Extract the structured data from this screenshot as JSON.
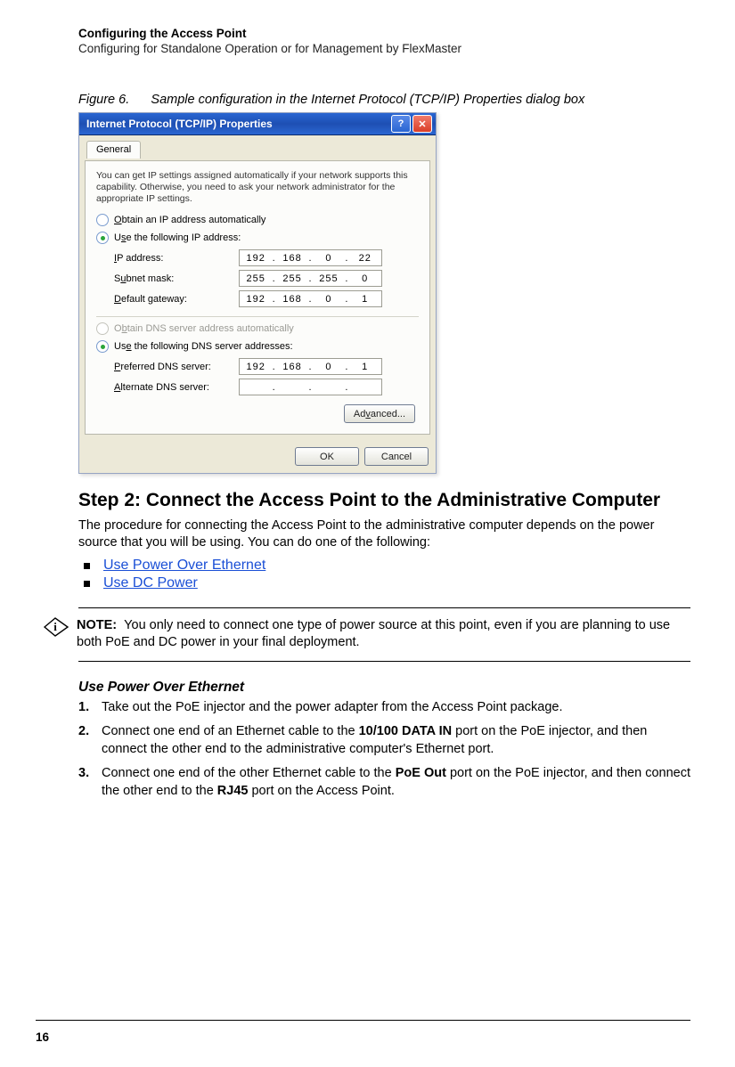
{
  "header": {
    "title": "Configuring the Access Point",
    "subtitle": "Configuring for Standalone Operation or for Management by FlexMaster"
  },
  "figure": {
    "label": "Figure 6.",
    "caption": "Sample configuration in the Internet Protocol (TCP/IP) Properties dialog box"
  },
  "dialog": {
    "title": "Internet Protocol (TCP/IP) Properties",
    "help": "?",
    "close": "✕",
    "tab": "General",
    "description": "You can get IP settings assigned automatically if your network supports this capability. Otherwise, you need to ask your network administrator for the appropriate IP settings.",
    "radio_auto_ip": "Obtain an IP address automatically",
    "radio_use_ip": "Use the following IP address:",
    "lbl_ip": "IP address:",
    "lbl_mask": "Subnet mask:",
    "lbl_gw": "Default gateway:",
    "ip_address": [
      "192",
      "168",
      "0",
      "22"
    ],
    "subnet_mask": [
      "255",
      "255",
      "255",
      "0"
    ],
    "default_gateway": [
      "192",
      "168",
      "0",
      "1"
    ],
    "radio_auto_dns": "Obtain DNS server address automatically",
    "radio_use_dns": "Use the following DNS server addresses:",
    "lbl_pref_dns": "Preferred DNS server:",
    "lbl_alt_dns": "Alternate DNS server:",
    "pref_dns": [
      "192",
      "168",
      "0",
      "1"
    ],
    "alt_dns": [
      "",
      "",
      "",
      ""
    ],
    "advanced": "Advanced...",
    "ok": "OK",
    "cancel": "Cancel"
  },
  "step2_heading": "Step 2: Connect the Access Point to the Administrative Computer",
  "step2_body": "The procedure for connecting the Access Point to the administrative computer depends on the power source that you will be using. You can do one of the following:",
  "links": {
    "poe": "Use Power Over Ethernet",
    "dc": "Use DC Power"
  },
  "note": {
    "label": "NOTE:",
    "text": "You only need to connect one type of power source at this point, even if you are planning to use both PoE and DC power in your final deployment."
  },
  "poe_heading": "Use Power Over Ethernet",
  "steps": {
    "s1": "Take out the PoE injector and the power adapter from the Access Point package.",
    "s2a": "Connect one end of an Ethernet cable to the ",
    "s2b": "10/100 DATA IN",
    "s2c": " port on the PoE injector, and then connect the other end to the administrative computer's Ethernet port.",
    "s3a": "Connect one end of the other Ethernet cable to the ",
    "s3b": "PoE Out",
    "s3c": " port on the PoE injector, and then connect the other end to the ",
    "s3d": "RJ45",
    "s3e": " port on the Access Point."
  },
  "pagenum": "16"
}
